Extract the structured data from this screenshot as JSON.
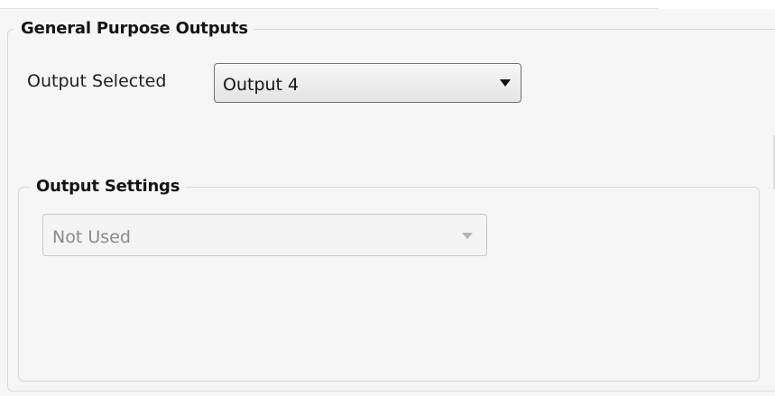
{
  "general_purpose_outputs": {
    "title": "General Purpose Outputs",
    "output_selected_label": "Output Selected",
    "output_selected_value": "Output 4"
  },
  "output_settings": {
    "title": "Output Settings",
    "mode_value": "Not Used",
    "mode_enabled": false
  },
  "icons": {
    "active_dropdown_arrow": "triangle-down-icon",
    "disabled_dropdown_arrow": "triangle-down-icon"
  }
}
